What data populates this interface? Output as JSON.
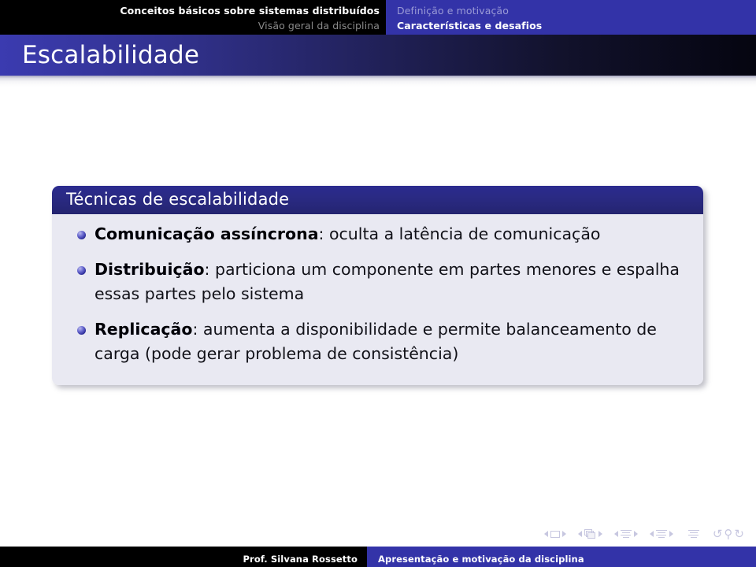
{
  "headline": {
    "left": {
      "line1": "Conceitos básicos sobre sistemas distribuídos",
      "line2": "Visão geral da disciplina"
    },
    "right": {
      "line1": "Definição e motivação",
      "line2": "Características e desafios"
    }
  },
  "frame": {
    "title": "Escalabilidade"
  },
  "block": {
    "title": "Técnicas de escalabilidade",
    "items": [
      {
        "lead": "Comunicação assíncrona",
        "separator": ": ",
        "text": "oculta a latência de comunicação"
      },
      {
        "lead": "Distribuição",
        "separator": ": ",
        "text": "particiona um componente em partes menores e espalha essas partes pelo sistema"
      },
      {
        "lead": "Replicação",
        "separator": ": ",
        "text": "aumenta a disponibilidade e permite balanceamento de carga (pode gerar problema de consistência)"
      }
    ]
  },
  "footline": {
    "author": "Prof. Silvana Rossetto",
    "subtitle": "Apresentação e motivação da disciplina"
  },
  "navsymbols": {
    "slide_prev": "◄",
    "slide": "slide-icon",
    "slide_next": "►",
    "frame_prev": "◄",
    "frame": "frames-icon",
    "frame_next": "►",
    "subsection_prev": "◄",
    "subsection": "subsection-icon",
    "subsection_next": "►",
    "section_prev": "◄",
    "section": "section-icon",
    "section_next": "►",
    "doc": "document-icon",
    "back": "↺",
    "search": "⚲",
    "forward": "↻"
  },
  "colors": {
    "structure_blue": "#3333a8",
    "title_gradient_start": "#3b3bb0",
    "block_title_bg": "#2b2b8f",
    "block_body_bg": "#e9e9f2",
    "black_panel": "#000000"
  }
}
